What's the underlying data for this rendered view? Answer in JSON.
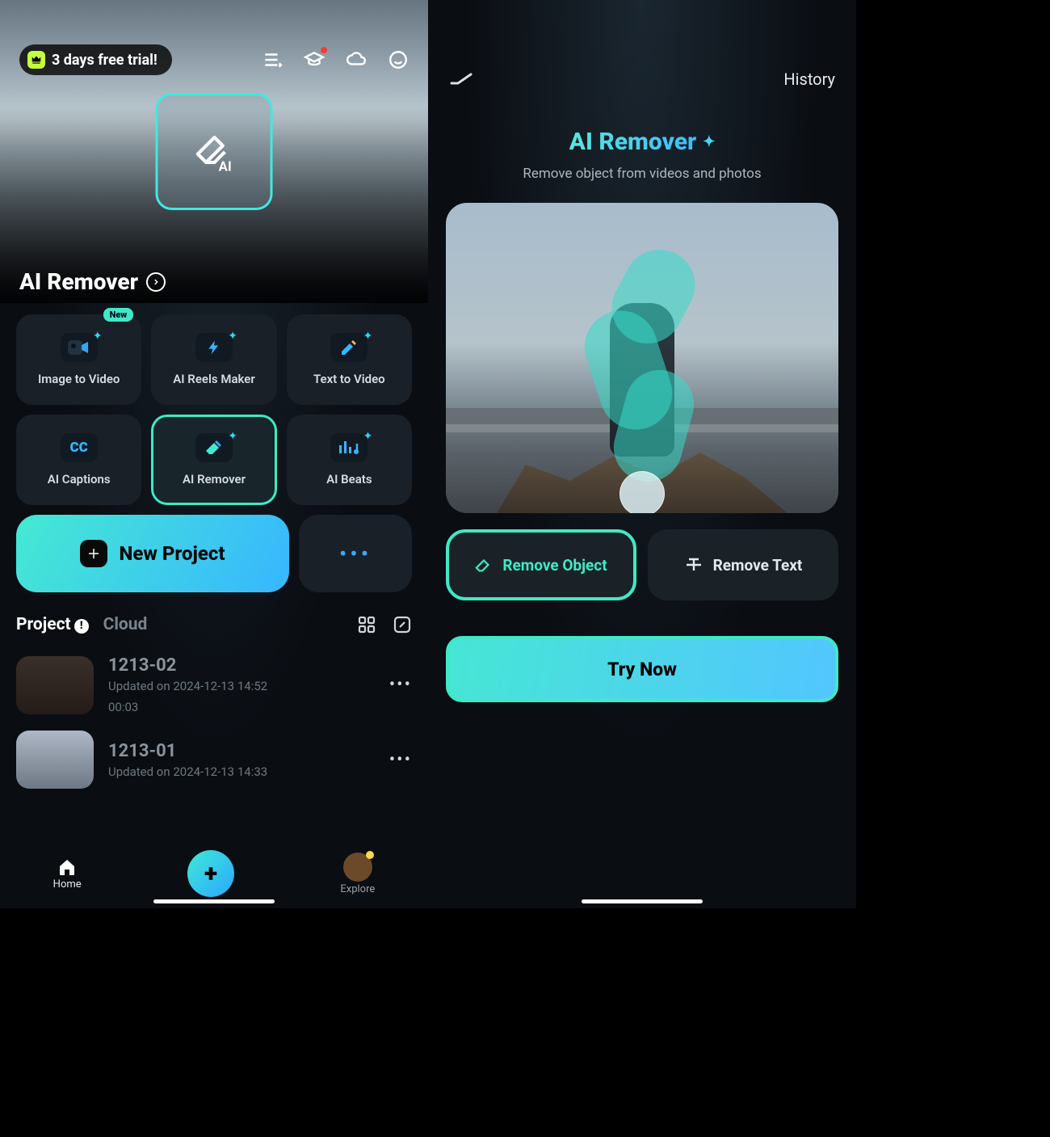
{
  "left": {
    "trial": {
      "text": "3 days free trial!"
    },
    "hero": {
      "title": "AI Remover"
    },
    "tools": [
      {
        "label": "Image to Video",
        "badge": "New",
        "icon": "camera-play-icon"
      },
      {
        "label": "AI Reels Maker",
        "icon": "bolt-icon"
      },
      {
        "label": "Text  to Video",
        "icon": "pencil-icon"
      },
      {
        "label": "AI Captions",
        "icon": "cc-icon"
      },
      {
        "label": "AI Remover",
        "icon": "eraser-icon",
        "selected": true
      },
      {
        "label": "AI Beats",
        "icon": "music-bars-icon"
      }
    ],
    "new_project": "New Project",
    "tabs": {
      "project": "Project",
      "cloud": "Cloud"
    },
    "projects": [
      {
        "name": "1213-02",
        "updated": "Updated on 2024-12-13 14:52",
        "duration": "00:03"
      },
      {
        "name": "1213-01",
        "updated": "Updated on 2024-12-13 14:33",
        "duration": ""
      }
    ],
    "nav": {
      "home": "Home",
      "explore": "Explore"
    }
  },
  "right": {
    "history": "History",
    "title": "AI Remover",
    "subtitle": "Remove object from videos and photos",
    "remove_object": "Remove Object",
    "remove_text": "Remove Text",
    "try_now": "Try Now"
  }
}
